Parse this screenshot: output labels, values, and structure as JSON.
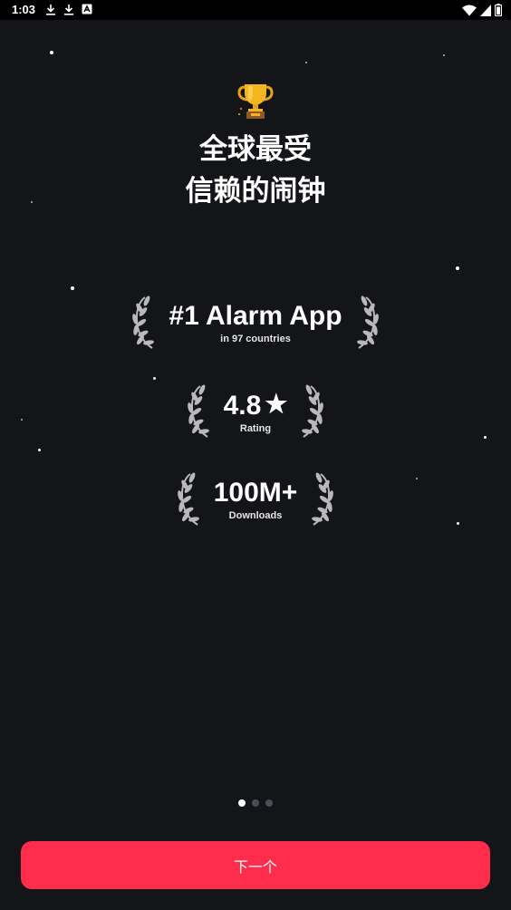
{
  "status_bar": {
    "time": "1:03",
    "left_icons": [
      "download-icon",
      "download-icon",
      "app-notification-icon"
    ],
    "right_icons": [
      "wifi-icon",
      "cellular-signal-icon",
      "battery-icon"
    ]
  },
  "onboarding": {
    "trophy_icon": "trophy-icon",
    "headline_line1": "全球最受",
    "headline_line2": "信赖的闹钟",
    "awards": [
      {
        "main": "#1 Alarm App",
        "sub": "in 97 countries"
      },
      {
        "main": "4.8",
        "main_suffix": "★",
        "sub": "Rating"
      },
      {
        "main": "100M+",
        "sub": "Downloads"
      }
    ],
    "page_indicator": {
      "total": 3,
      "active": 1
    }
  },
  "footer": {
    "next_label": "下一个"
  },
  "colors": {
    "background": "#141518",
    "accent": "#ff2d4b",
    "dot_inactive": "#4a4e5a"
  }
}
